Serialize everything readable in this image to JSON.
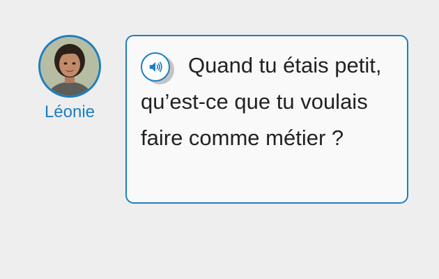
{
  "speaker": {
    "name": "Léonie",
    "avatar_icon": "person-portrait"
  },
  "bubble": {
    "text": "Quand tu étais petit, qu’est-ce que tu voulais faire comme métier ?",
    "audio_icon": "speaker-icon"
  },
  "colors": {
    "accent": "#1b7ec2",
    "background": "#eeeeee",
    "bubble_bg": "#f9f9f9",
    "text": "#222222"
  }
}
